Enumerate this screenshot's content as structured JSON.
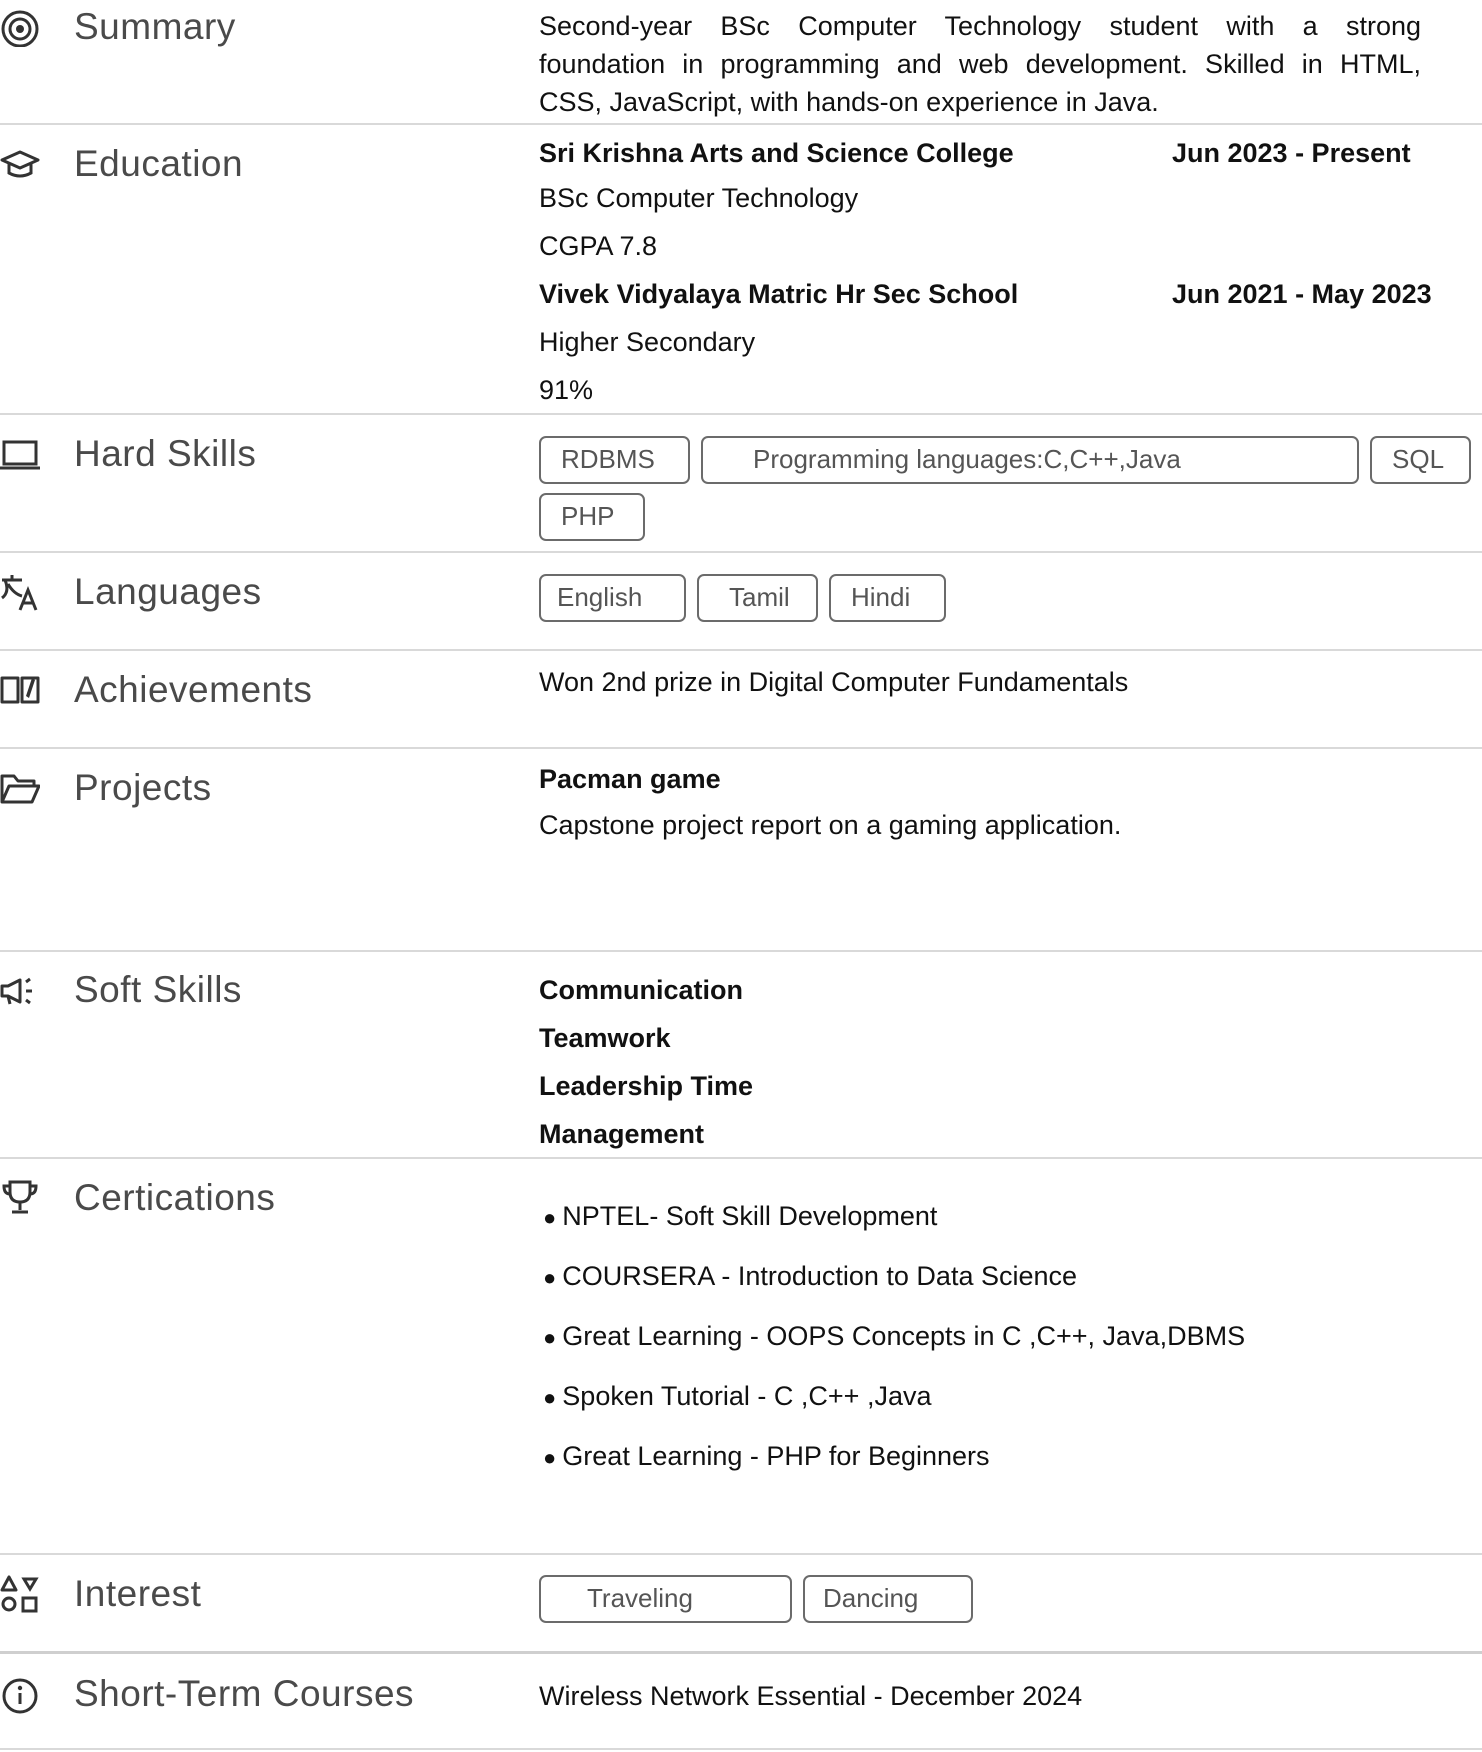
{
  "summary": {
    "title": "Summary",
    "icon": "target-icon",
    "text_lines": [
      "Second-year BSc Computer Technology student with a strong",
      "foundation in programming and web development. Skilled in HTML,",
      "CSS, JavaScript, with hands-on experience in Java."
    ]
  },
  "education": {
    "title": "Education",
    "icon": "graduation-cap-icon",
    "entries": [
      {
        "institution": "Sri Krishna Arts and Science College",
        "dates": "Jun 2023 - Present",
        "degree": "BSc Computer Technology",
        "score": "CGPA 7.8"
      },
      {
        "institution": "Vivek Vidyalaya Matric Hr Sec School",
        "dates": "Jun 2021 - May 2023",
        "degree": "Higher Secondary",
        "score": "91%"
      }
    ]
  },
  "hard_skills": {
    "title": "Hard Skills",
    "icon": "laptop-icon",
    "tags": [
      "RDBMS",
      "Programming languages:C,C++,Java",
      "SQL",
      "PHP"
    ]
  },
  "languages": {
    "title": "Languages",
    "icon": "translate-icon",
    "tags": [
      "English",
      "Tamil",
      "Hindi"
    ]
  },
  "achievements": {
    "title": "Achievements",
    "icon": "open-book-icon",
    "text": "Won 2nd prize in Digital Computer Fundamentals"
  },
  "projects": {
    "title": "Projects",
    "icon": "folder-open-icon",
    "name": "Pacman game",
    "description": "Capstone project report on a gaming application."
  },
  "soft_skills": {
    "title": "Soft Skills",
    "icon": "megaphone-icon",
    "items": [
      "Communication",
      "Teamwork",
      "Leadership Time",
      "Management"
    ]
  },
  "certifications": {
    "title": "Certications",
    "icon": "trophy-icon",
    "bullet": "●",
    "items": [
      "NPTEL- Soft Skill Development",
      "COURSERA - Introduction to Data Science",
      "Great Learning - OOPS Concepts in C ,C++, Java,DBMS",
      "Spoken Tutorial - C ,C++ ,Java",
      "Great Learning - PHP for Beginners"
    ]
  },
  "interest": {
    "title": "Interest",
    "icon": "shapes-icon",
    "tags": [
      "Traveling",
      "Dancing"
    ]
  },
  "short_term_courses": {
    "title": "Short-Term Courses",
    "icon": "info-icon",
    "text": "Wireless Network Essential - December 2024"
  }
}
